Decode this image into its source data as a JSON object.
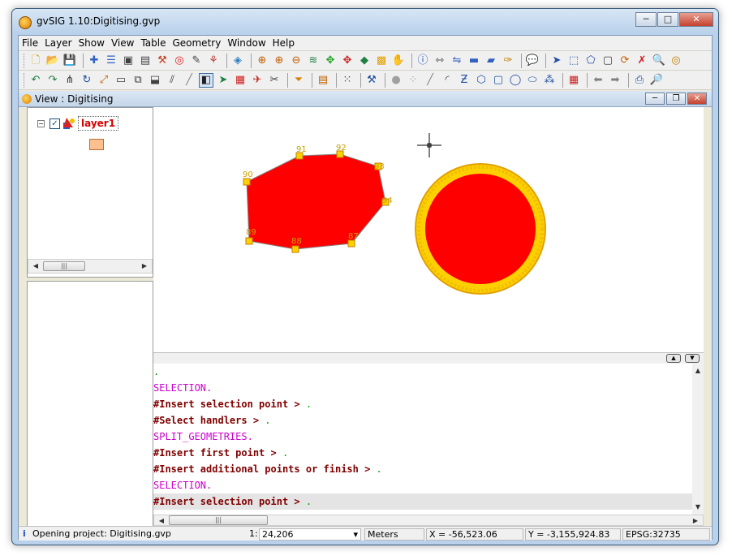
{
  "window": {
    "title": "gvSIG 1.10:Digitising.gvp"
  },
  "menu": [
    "File",
    "Layer",
    "Show",
    "View",
    "Table",
    "Geometry",
    "Window",
    "Help"
  ],
  "view": {
    "title": "View : Digitising"
  },
  "toc": {
    "layer_name": "layer1",
    "checked": true,
    "symbol_color": "#ffc090"
  },
  "map": {
    "polygon_fill": "#ff0000",
    "vertex_color": "#ffd700",
    "vertices": [
      "87",
      "88",
      "89",
      "90",
      "91",
      "92",
      "93",
      "94"
    ]
  },
  "console": {
    "lines": [
      {
        "text": ".",
        "style": "green"
      },
      {
        "text": "SELECTION.",
        "style": "pink"
      },
      {
        "text": "#Insert selection point > ",
        "style": "red"
      },
      {
        "text": "#Select handlers > ",
        "style": "red"
      },
      {
        "text": "SPLIT_GEOMETRIES.",
        "style": "pink"
      },
      {
        "text": "#Insert first point > ",
        "style": "red"
      },
      {
        "text": "#Insert additional points or finish > ",
        "style": "red"
      },
      {
        "text": "SELECTION.",
        "style": "pink"
      },
      {
        "text": "#Insert selection point > ",
        "style": "red"
      }
    ]
  },
  "status": {
    "message": "Opening project: Digitising.gvp",
    "scale_prefix": "1:",
    "scale": "24,206",
    "units": "Meters",
    "x": "X = -56,523.06",
    "y": "Y = -3,155,924.83",
    "epsg": "EPSG:32735"
  }
}
